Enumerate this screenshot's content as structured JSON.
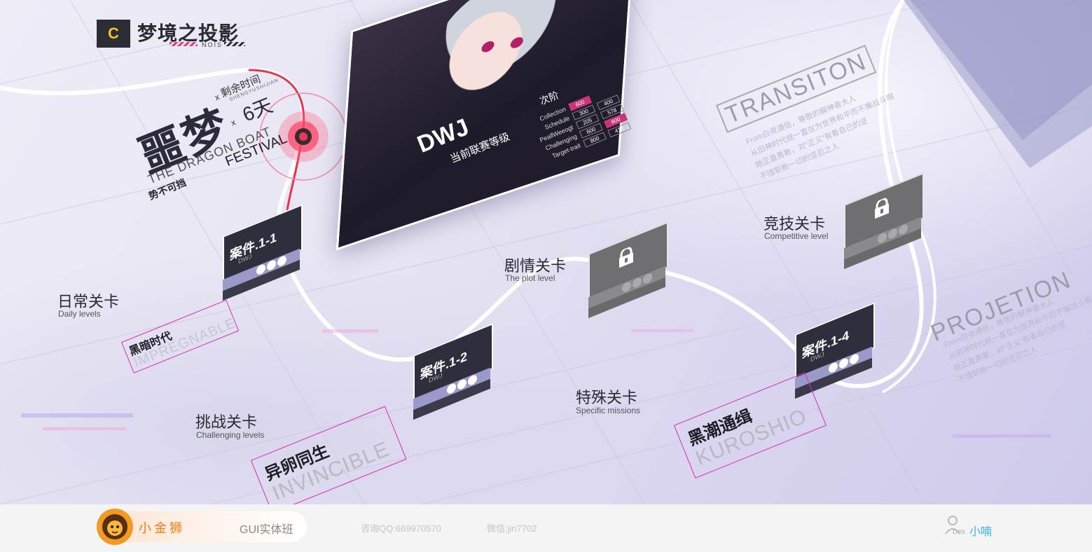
{
  "logo": {
    "mark": "C",
    "title": "梦境之投影",
    "subtitle": "NOIS"
  },
  "event": {
    "title": "噩梦",
    "en_line1": "THE DRAGON BOAT",
    "en_line2": "FESTIVAL",
    "tag": "势不可挡",
    "remaining_label": "剩余时间",
    "remaining_sub": "SHENGYUSHIJIAN",
    "remaining_value": "6天",
    "x_mark": "x"
  },
  "hero": {
    "name": "DWJ",
    "rank_label": "当前联赛等级",
    "tier_label": "次阶",
    "stats": [
      {
        "label": "Collection",
        "a": "600",
        "b": "",
        "c": ""
      },
      {
        "label": "Schedule",
        "a": "300",
        "b": "",
        "c": "400"
      },
      {
        "label": "PeallWeeogt",
        "a": "205",
        "b": "578",
        "c": ""
      },
      {
        "label": "Challenging",
        "a": "600",
        "b": "",
        "c": "600"
      },
      {
        "label": "Target-trait",
        "a": "800",
        "b": "416",
        "c": ""
      }
    ]
  },
  "nodes": [
    {
      "code": "案件.1-1",
      "sub": "DWJ",
      "locked": false
    },
    {
      "code": "案件.1-2",
      "sub": "DWJ",
      "locked": false
    },
    {
      "code": "",
      "sub": "",
      "locked": true
    },
    {
      "code": "",
      "sub": "",
      "locked": true
    },
    {
      "code": "案件.1-4",
      "sub": "DWJ",
      "locked": false
    }
  ],
  "levels": {
    "daily": {
      "zh": "日常关卡",
      "en": "Daily levels"
    },
    "challenge": {
      "zh": "挑战关卡",
      "en": "Challenging levels"
    },
    "plot": {
      "zh": "剧情关卡",
      "en": "The plot level"
    },
    "special": {
      "zh": "特殊关卡",
      "en": "Specific missions"
    },
    "competitive": {
      "zh": "竞技关卡",
      "en": "Competitive level"
    }
  },
  "tags": {
    "t1": {
      "zh": "黑暗时代",
      "en": "IMPREGNABLE"
    },
    "t2": {
      "zh": "异卵同生",
      "en": "INVINCIBLE"
    },
    "t3": {
      "zh": "黑潮通缉",
      "en": "KUROSHIO"
    }
  },
  "deco": {
    "transition": "TRANSITON",
    "projection": "PROJETION",
    "from_line1": "From白夜通信，尊敬的解神者大人",
    "from_line2": "从旧神时代就一直在为世界和平而不懈战斗啊",
    "from_line3": "她正直勇敢，对“正义”有着自己的坚",
    "from_line4": "不惜斩断一切的坚忍之人"
  },
  "footer": {
    "brand": "小金狮",
    "course": "GUI实体班",
    "qq": "咨询QQ:669970570",
    "wechat": "微信:jin7702",
    "user_des": "Des",
    "user_name": "小喃"
  },
  "colors": {
    "accent_pink": "#d330b6",
    "brand_orange": "#f17c12",
    "user_blue": "#3db2e8",
    "node_dark": "#2e2e3d",
    "node_band": "#9b99c9"
  }
}
